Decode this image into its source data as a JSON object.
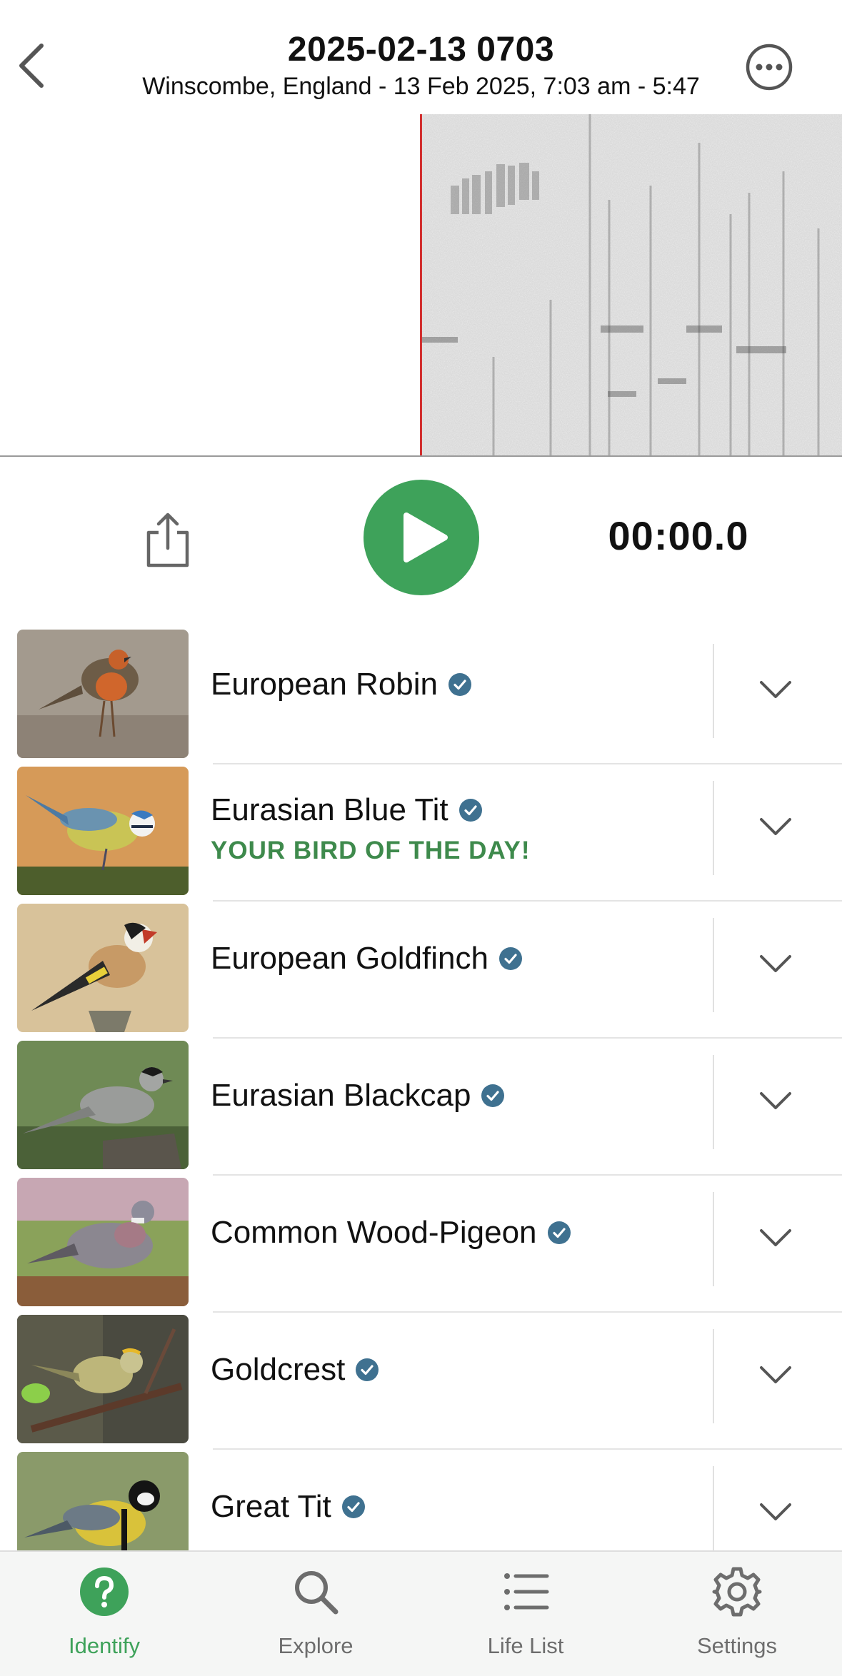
{
  "header": {
    "title": "2025-02-13 0703",
    "subtitle": "Winscombe, England - 13 Feb 2025, 7:03 am - 5:47"
  },
  "player": {
    "timer": "00:00.0"
  },
  "birds": [
    {
      "name": "European Robin",
      "badge": "",
      "verified": true
    },
    {
      "name": "Eurasian Blue Tit",
      "badge": "YOUR BIRD OF THE DAY!",
      "verified": true
    },
    {
      "name": "European Goldfinch",
      "badge": "",
      "verified": true
    },
    {
      "name": "Eurasian Blackcap",
      "badge": "",
      "verified": true
    },
    {
      "name": "Common Wood-Pigeon",
      "badge": "",
      "verified": true
    },
    {
      "name": "Goldcrest",
      "badge": "",
      "verified": true
    },
    {
      "name": "Great Tit",
      "badge": "",
      "verified": true
    }
  ],
  "tabs": [
    {
      "label": "Identify",
      "icon": "identify-icon",
      "active": true
    },
    {
      "label": "Explore",
      "icon": "search-icon",
      "active": false
    },
    {
      "label": "Life List",
      "icon": "list-icon",
      "active": false
    },
    {
      "label": "Settings",
      "icon": "gear-icon",
      "active": false
    }
  ],
  "colors": {
    "accent": "#3ea25a",
    "verified_badge": "#3f7190",
    "bird_of_day": "#3e8a4c",
    "playhead": "#d23030"
  }
}
